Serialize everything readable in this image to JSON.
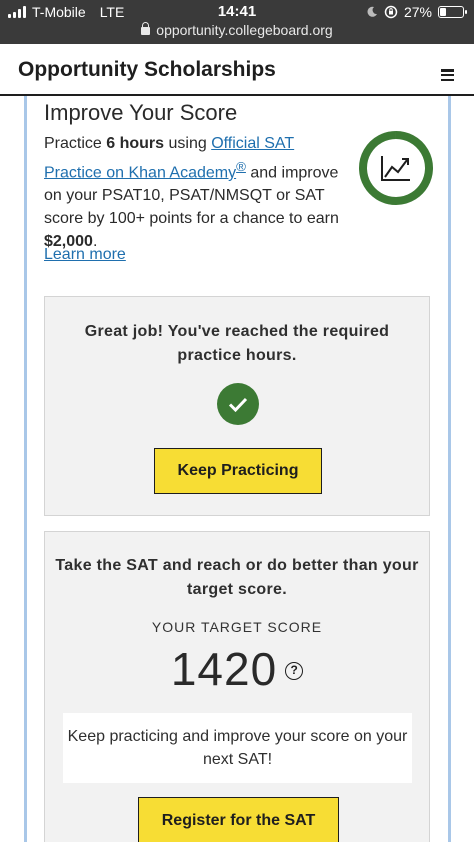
{
  "status_bar": {
    "carrier": "T-Mobile",
    "network": "LTE",
    "time": "14:41",
    "battery": "27%",
    "battery_level": 0.27,
    "url": "opportunity.collegeboard.org"
  },
  "header": {
    "title": "Opportunity Scholarships",
    "menu_icon": "hamburger-menu-icon"
  },
  "improve": {
    "title": "Improve Your Score",
    "text_1": "Practice ",
    "hours": "6 hours",
    "text_2": " using ",
    "link": "Official SAT Practice on Khan Academy",
    "reg_mark": "®",
    "text_3": " and improve on your PSAT10, PSAT/NMSQT or SAT score by 100+ points for a chance to earn ",
    "amount": "$2,000",
    "text_4": ".",
    "learn_more": "Learn more",
    "progress_icon": "trending-up-chart-icon",
    "progress_fraction": 1.0,
    "progress_color": "#3c7a34"
  },
  "practice_card": {
    "heading": "Great job! You've reached the required practice hours.",
    "check_icon": "checkmark-icon",
    "button": "Keep Practicing"
  },
  "sat_card": {
    "heading": "Take the SAT and reach or do better than your target score.",
    "target_label": "YOUR TARGET SCORE",
    "target_score": "1420",
    "help_icon": "?",
    "note": "Keep practicing and improve your score on your next SAT!",
    "button": "Register for the SAT"
  },
  "colors": {
    "accent_yellow": "#f7dd34",
    "success_green": "#3c7a34",
    "link_blue": "#1f6fae"
  }
}
